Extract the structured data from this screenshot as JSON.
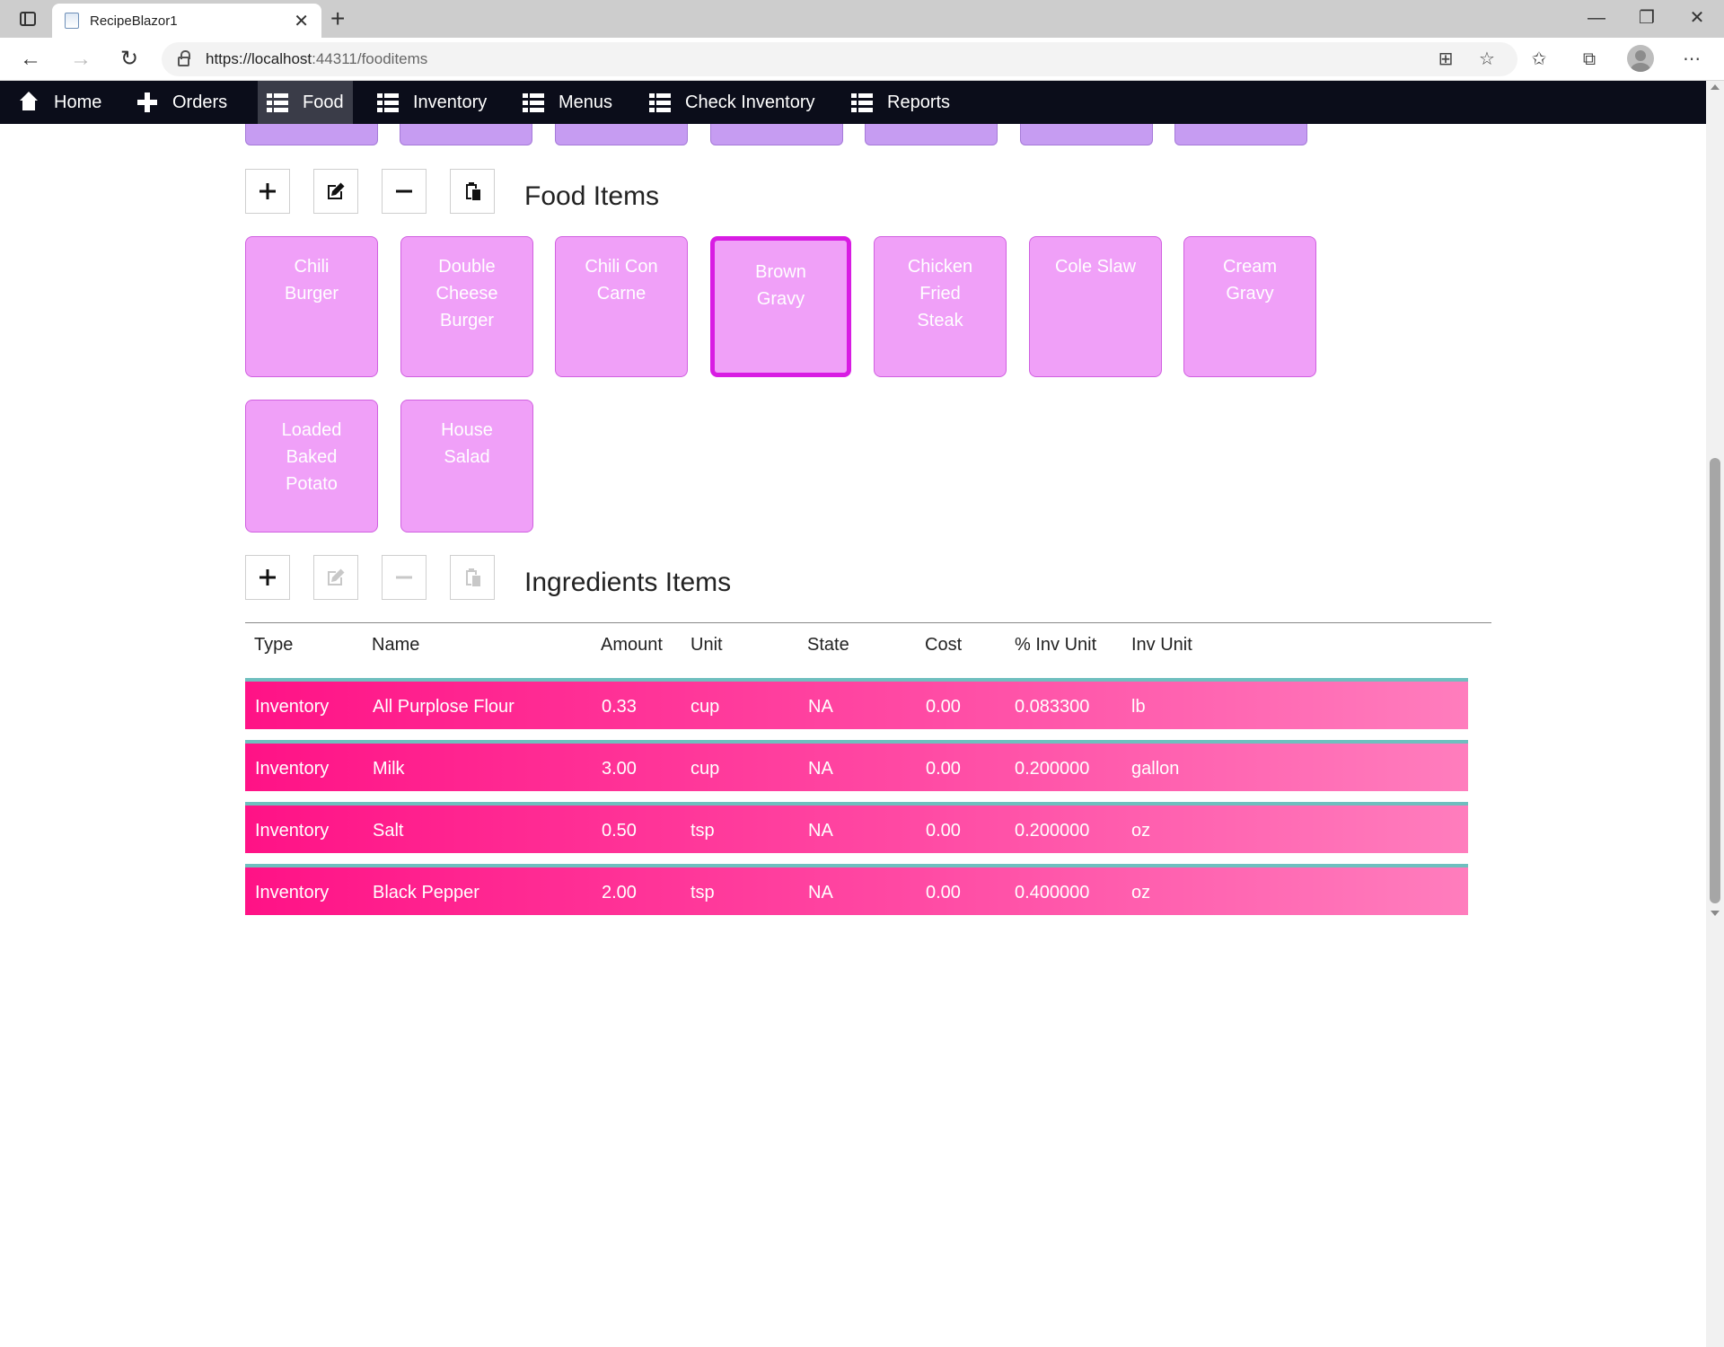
{
  "browser": {
    "tab_title": "RecipeBlazor1",
    "url_host": "https://localhost",
    "url_rest": ":44311/fooditems"
  },
  "nav": {
    "items": [
      {
        "label": "Home",
        "icon": "home-icon"
      },
      {
        "label": "Orders",
        "icon": "plus-icon"
      },
      {
        "label": "Food",
        "icon": "list-icon",
        "active": true
      },
      {
        "label": "Inventory",
        "icon": "list-icon"
      },
      {
        "label": "Menus",
        "icon": "list-icon"
      },
      {
        "label": "Check Inventory",
        "icon": "list-icon"
      },
      {
        "label": "Reports",
        "icon": "list-icon"
      }
    ]
  },
  "food_section": {
    "title": "Food Items",
    "toolbar": [
      "add",
      "edit",
      "remove",
      "copy"
    ],
    "items": [
      {
        "line1": "Chili",
        "line2": "Burger",
        "line3": ""
      },
      {
        "line1": "Double",
        "line2": "Cheese",
        "line3": "Burger"
      },
      {
        "line1": "Chili Con",
        "line2": "Carne",
        "line3": ""
      },
      {
        "line1": "Brown",
        "line2": "Gravy",
        "line3": "",
        "selected": true
      },
      {
        "line1": "Chicken",
        "line2": "Fried",
        "line3": "Steak"
      },
      {
        "line1": "Cole Slaw",
        "line2": "",
        "line3": ""
      },
      {
        "line1": "Cream",
        "line2": "Gravy",
        "line3": ""
      },
      {
        "line1": "Loaded",
        "line2": "Baked",
        "line3": "Potato"
      },
      {
        "line1": "House",
        "line2": "Salad",
        "line3": ""
      }
    ]
  },
  "ingredients_section": {
    "title": "Ingredients Items",
    "columns": [
      "Type",
      "Name",
      "Amount",
      "Unit",
      "State",
      "Cost",
      "% Inv Unit",
      "Inv Unit"
    ],
    "rows": [
      [
        "Inventory",
        "All Purplose Flour",
        "0.33",
        "cup",
        "NA",
        "0.00",
        "0.083300",
        "lb"
      ],
      [
        "Inventory",
        "Milk",
        "3.00",
        "cup",
        "NA",
        "0.00",
        "0.200000",
        "gallon"
      ],
      [
        "Inventory",
        "Salt",
        "0.50",
        "tsp",
        "NA",
        "0.00",
        "0.200000",
        "oz"
      ],
      [
        "Inventory",
        "Black Pepper",
        "2.00",
        "tsp",
        "NA",
        "0.00",
        "0.400000",
        "oz"
      ]
    ]
  },
  "colors": {
    "nav_bg": "#0b0d1a",
    "food_tile": "#f0a0f8",
    "food_tile_selected_border": "#d81ce3",
    "ingredient_row": "#ff1286"
  }
}
